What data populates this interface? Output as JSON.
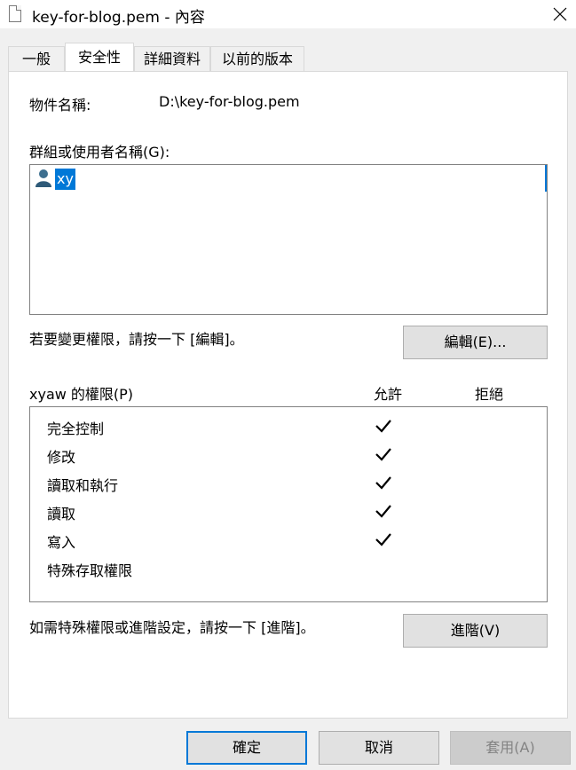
{
  "window": {
    "title": "key-for-blog.pem - 內容"
  },
  "tabs": [
    {
      "label": "一般"
    },
    {
      "label": "安全性"
    },
    {
      "label": "詳細資料"
    },
    {
      "label": "以前的版本"
    }
  ],
  "object": {
    "label": "物件名稱:",
    "value": "D:\\key-for-blog.pem"
  },
  "groups": {
    "label": "群組或使用者名稱(G):",
    "selected_user": "xy"
  },
  "edit_hint": "若要變更權限，請按一下 [編輯]。",
  "edit_button": "編輯(E)...",
  "permissions": {
    "title": "xyaw 的權限(P)",
    "allow_header": "允許",
    "deny_header": "拒絕",
    "rows": [
      {
        "name": "完全控制",
        "allow": true,
        "deny": false
      },
      {
        "name": "修改",
        "allow": true,
        "deny": false
      },
      {
        "name": "讀取和執行",
        "allow": true,
        "deny": false
      },
      {
        "name": "讀取",
        "allow": true,
        "deny": false
      },
      {
        "name": "寫入",
        "allow": true,
        "deny": false
      },
      {
        "name": "特殊存取權限",
        "allow": false,
        "deny": false
      }
    ]
  },
  "advanced_hint": "如需特殊權限或進階設定，請按一下 [進階]。",
  "advanced_button": "進階(V)",
  "footer": {
    "ok": "確定",
    "cancel": "取消",
    "apply": "套用(A)"
  }
}
